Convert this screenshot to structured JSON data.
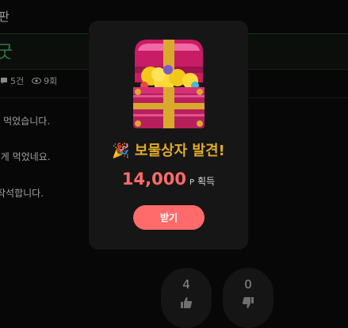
{
  "board": {
    "title": "판"
  },
  "post": {
    "title": "굿",
    "comments": "5건",
    "views": "9회",
    "lines": [
      "- 먹었습니다.",
      "!게 먹었네요.",
      "작석합니다."
    ]
  },
  "votes": {
    "up": "4",
    "down": "0"
  },
  "modal": {
    "title": "보물상자 발견!",
    "amount": "14,000",
    "unit": "P",
    "suffix": "획득",
    "button": "받기",
    "accent": "#ff6b6b",
    "title_color": "#e0a92a"
  }
}
